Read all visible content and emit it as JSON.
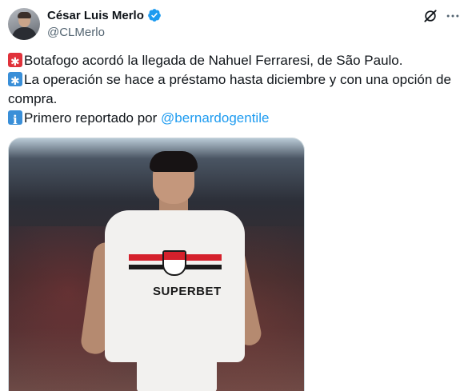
{
  "author": {
    "display_name": "César Luis Merlo",
    "handle": "@CLMerlo",
    "verified": true,
    "verified_color": "#1d9bf0"
  },
  "tweet": {
    "line1_emoji": "siren-emoji",
    "line1_text": "Botafogo acordó la llegada de Nahuel Ferraresi, de São Paulo.",
    "line2_emoji": "asterisk-emoji",
    "line2_text": "La operación se hace a préstamo hasta diciembre y con una opción de compra.",
    "line3_emoji": "info-emoji",
    "line3_text": "Primero reportado por ",
    "line3_mention": "@bernardogentile",
    "mention_color": "#1d9bf0"
  },
  "media": {
    "sponsor_text": "SUPERBET"
  },
  "icons": {
    "grok": "grok-icon",
    "more": "more-icon"
  }
}
